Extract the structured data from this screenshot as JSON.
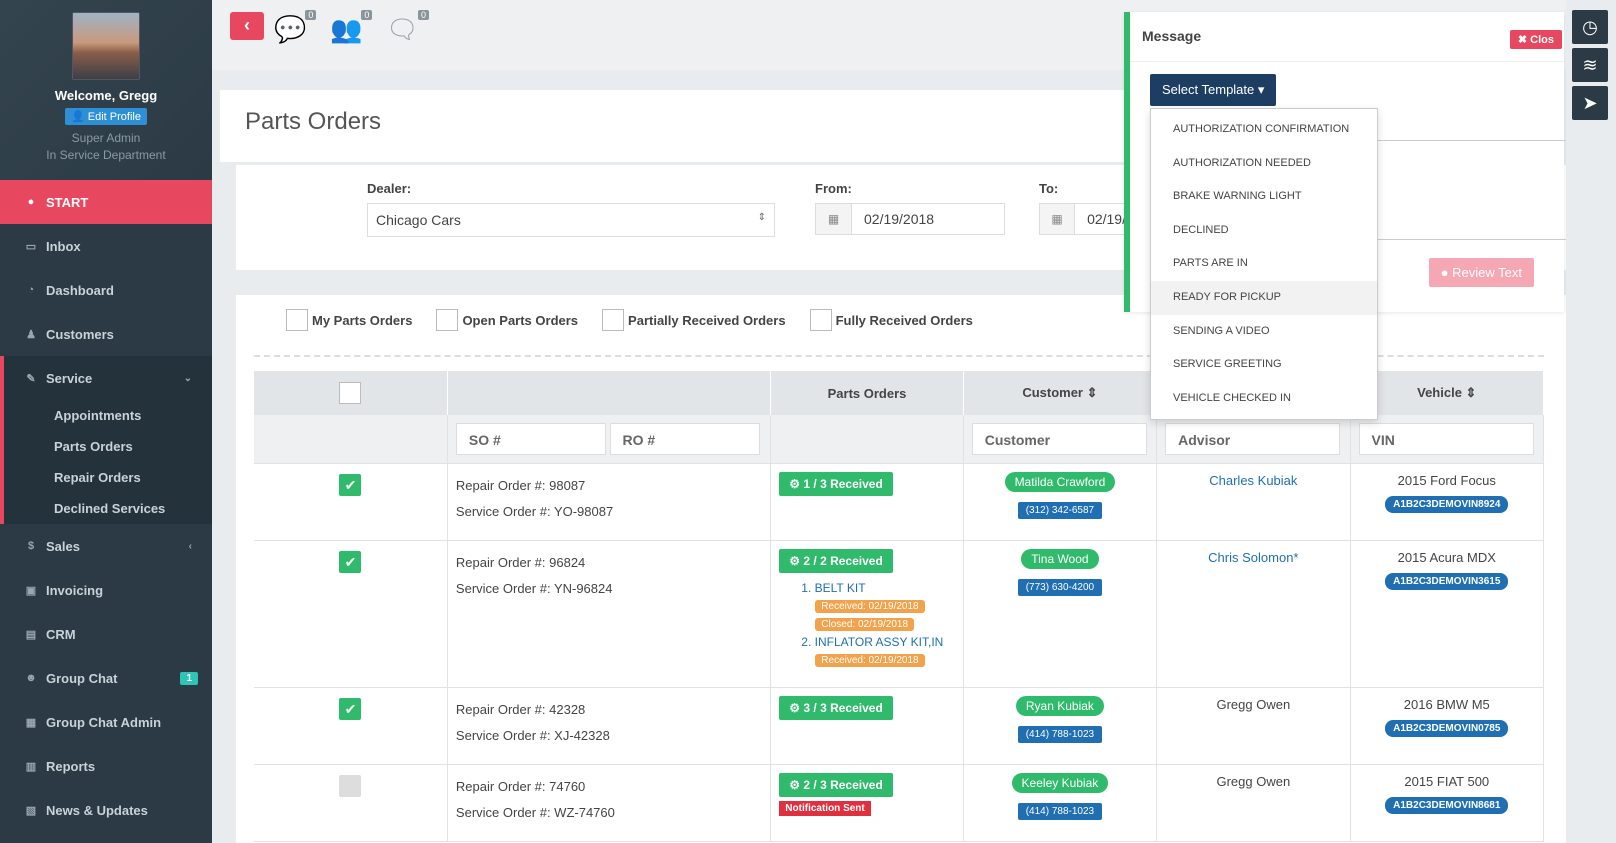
{
  "profile": {
    "welcome": "Welcome, Gregg",
    "edit_label": "Edit Profile",
    "role1": "Super Admin",
    "role2": "In Service Department"
  },
  "nav": {
    "start": "START",
    "inbox": "Inbox",
    "dashboard": "Dashboard",
    "customers": "Customers",
    "service": "Service",
    "service_sub": [
      "Appointments",
      "Parts Orders",
      "Repair Orders",
      "Declined Services"
    ],
    "sales": "Sales",
    "invoicing": "Invoicing",
    "crm": "CRM",
    "group_chat": "Group Chat",
    "group_chat_badge": "1",
    "group_chat_admin": "Group Chat Admin",
    "reports": "Reports",
    "news": "News & Updates"
  },
  "topbar": {
    "back": "‹",
    "counts": [
      "0",
      "0",
      "0"
    ]
  },
  "page": {
    "title": "Parts Orders"
  },
  "filters": {
    "dealer_label": "Dealer:",
    "dealer_value": "Chicago Cars",
    "from_label": "From:",
    "from_value": "02/19/2018",
    "to_label": "To:",
    "to_value": "02/19/"
  },
  "checkbox_filters": [
    "My Parts Orders",
    "Open Parts Orders",
    "Partially Received Orders",
    "Fully Received Orders"
  ],
  "table": {
    "headers": {
      "parts_orders": "Parts Orders",
      "customer": "Customer ⇕",
      "vehicle": "Vehicle ⇕"
    },
    "filters": {
      "so": "SO #",
      "ro": "RO #",
      "customer": "Customer",
      "advisor": "Advisor",
      "vin": "VIN"
    },
    "rows": [
      {
        "ro": "Repair Order #: 98087",
        "so": "Service Order #: YO-98087",
        "received": "⚙ 1 / 3 Received",
        "customer": "Matilda Crawford",
        "phone": "(312) 342-6587",
        "advisor": "Charles Kubiak",
        "vehicle": "2015 Ford Focus",
        "vin": "A1B2C3DEMOVIN8924"
      },
      {
        "ro": "Repair Order #: 96824",
        "so": "Service Order #: YN-96824",
        "received": "⚙ 2 / 2 Received",
        "customer": "Tina Wood",
        "phone": "(773) 630-4200",
        "advisor": "Chris Solomon*",
        "vehicle": "2015 Acura MDX",
        "vin": "A1B2C3DEMOVIN3615",
        "part1": "1. BELT KIT",
        "part1_recv": "Received: 02/19/2018",
        "part1_closed": "Closed: 02/19/2018",
        "part2": "2. INFLATOR ASSY KIT,IN",
        "part2_recv": "Received: 02/19/2018"
      },
      {
        "ro": "Repair Order #: 42328",
        "so": "Service Order #: XJ-42328",
        "received": "⚙ 3 / 3 Received",
        "customer": "Ryan Kubiak",
        "phone": "(414) 788-1023",
        "advisor": "Gregg Owen",
        "vehicle": "2016 BMW M5",
        "vin": "A1B2C3DEMOVIN0785"
      },
      {
        "ro": "Repair Order #: 74760",
        "so": "Service Order #: WZ-74760",
        "received": "⚙ 2 / 3 Received",
        "notification": "Notification Sent",
        "customer": "Keeley Kubiak",
        "phone": "(414) 788-1023",
        "advisor": "Gregg Owen",
        "vehicle": "2015 FIAT 500",
        "vin": "A1B2C3DEMOVIN8681"
      }
    ]
  },
  "message": {
    "title": "Message",
    "close": "✖ Clos",
    "select_template": "Select Template ▾",
    "review": "Review Text",
    "templates": [
      "AUTHORIZATION CONFIRMATION",
      "AUTHORIZATION NEEDED",
      "BRAKE WARNING LIGHT",
      "DECLINED",
      "PARTS ARE IN",
      "READY FOR PICKUP",
      "SENDING A VIDEO",
      "SERVICE GREETING",
      "VEHICLE CHECKED IN"
    ]
  },
  "colors": {
    "accent": "#e8485f",
    "sidebar": "#2b3a44",
    "green": "#2fbb6b",
    "blue": "#1f6fb2",
    "navy": "#1d3d63"
  }
}
